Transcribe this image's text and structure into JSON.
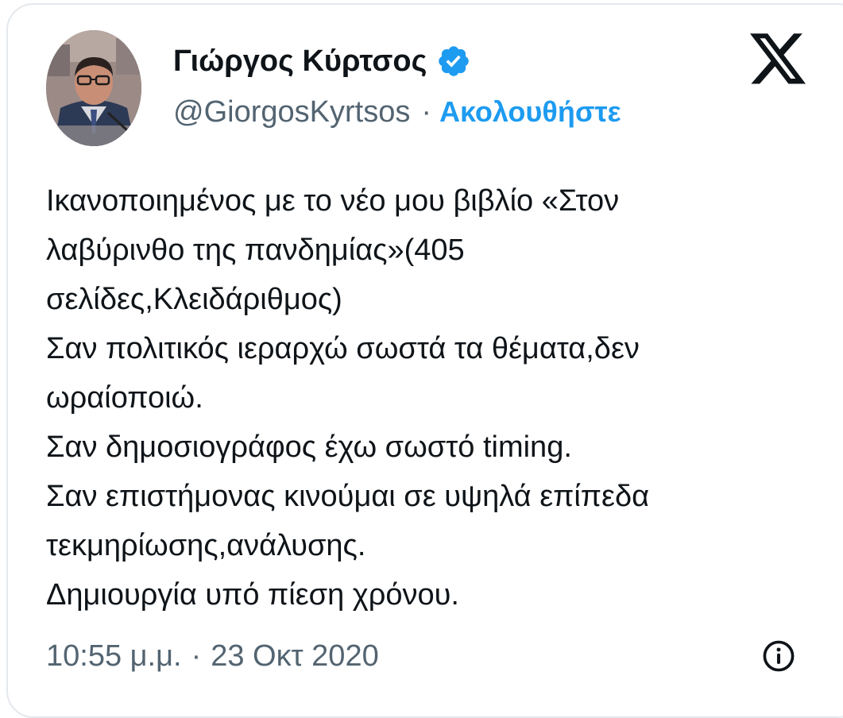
{
  "author": {
    "name": "Γιώργος Κύρτσος",
    "handle": "@GiorgosKyrtsos",
    "verified_icon": "verified-badge-icon",
    "avatar": "profile-photo"
  },
  "header": {
    "separator": "·",
    "follow_label": "Ακολουθήστε",
    "logo_icon": "x-logo-icon"
  },
  "tweet": {
    "lines": [
      "Ικανοποιημένος με το νέο μου βιβλίο «Στον",
      "λαβύρινθο της πανδημίας»(405",
      "σελίδες,Κλειδάριθμος)",
      "Σαν πολιτικός ιεραρχώ σωστά τα θέματα,δεν",
      "ωραίοποιώ.",
      "Σαν δημοσιογράφος έχω σωστό timing.",
      "Σαν επιστήμονας κινούμαι σε υψηλά επίπεδα",
      "τεκμηρίωσης,ανάλυσης.",
      "Δημιουργία υπό πίεση χρόνου."
    ]
  },
  "meta": {
    "time": "10:55 μ.μ.",
    "separator": "·",
    "date": "23 Οκτ 2020",
    "info_icon": "info-icon"
  },
  "colors": {
    "text": "#0f1419",
    "secondary": "#536471",
    "accent": "#1d9bf0",
    "border": "#e4e8ec"
  }
}
